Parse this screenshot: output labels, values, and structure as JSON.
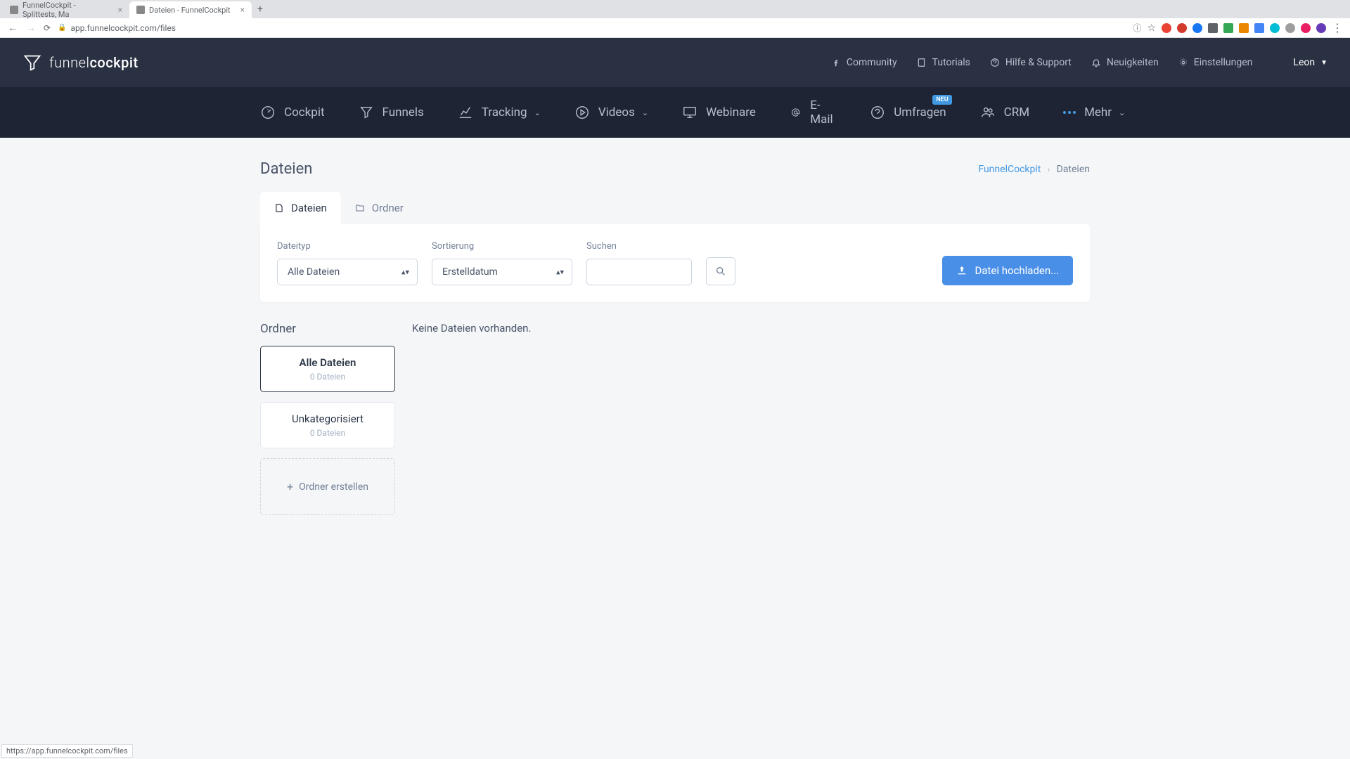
{
  "browser": {
    "tabs": [
      {
        "title": "FunnelCockpit - Splittests, Ma",
        "active": false
      },
      {
        "title": "Dateien - FunnelCockpit",
        "active": true
      }
    ],
    "url": "app.funnelcockpit.com/files",
    "status_url": "https://app.funnelcockpit.com/files"
  },
  "header": {
    "logo_prefix": "funnel",
    "logo_suffix": "cockpit",
    "links": [
      {
        "label": "Community"
      },
      {
        "label": "Tutorials"
      },
      {
        "label": "Hilfe & Support"
      },
      {
        "label": "Neuigkeiten"
      },
      {
        "label": "Einstellungen"
      }
    ],
    "user": "Leon"
  },
  "nav": {
    "items": [
      {
        "label": "Cockpit"
      },
      {
        "label": "Funnels"
      },
      {
        "label": "Tracking",
        "dropdown": true
      },
      {
        "label": "Videos",
        "dropdown": true
      },
      {
        "label": "Webinare"
      },
      {
        "label": "E-Mail"
      },
      {
        "label": "Umfragen",
        "badge": "NEU"
      },
      {
        "label": "CRM"
      }
    ],
    "more": "Mehr"
  },
  "page": {
    "title": "Dateien",
    "breadcrumb_root": "FunnelCockpit",
    "breadcrumb_current": "Dateien"
  },
  "tabs": {
    "files": "Dateien",
    "folders": "Ordner"
  },
  "filters": {
    "filetype_label": "Dateityp",
    "filetype_value": "Alle Dateien",
    "sort_label": "Sortierung",
    "sort_value": "Erstelldatum",
    "search_label": "Suchen",
    "upload_label": "Datei hochladen..."
  },
  "sidebar": {
    "title": "Ordner",
    "folders": [
      {
        "name": "Alle Dateien",
        "count": "0 Dateien"
      },
      {
        "name": "Unkategorisiert",
        "count": "0 Dateien"
      }
    ],
    "create_label": "Ordner erstellen"
  },
  "content": {
    "empty": "Keine Dateien vorhanden."
  }
}
